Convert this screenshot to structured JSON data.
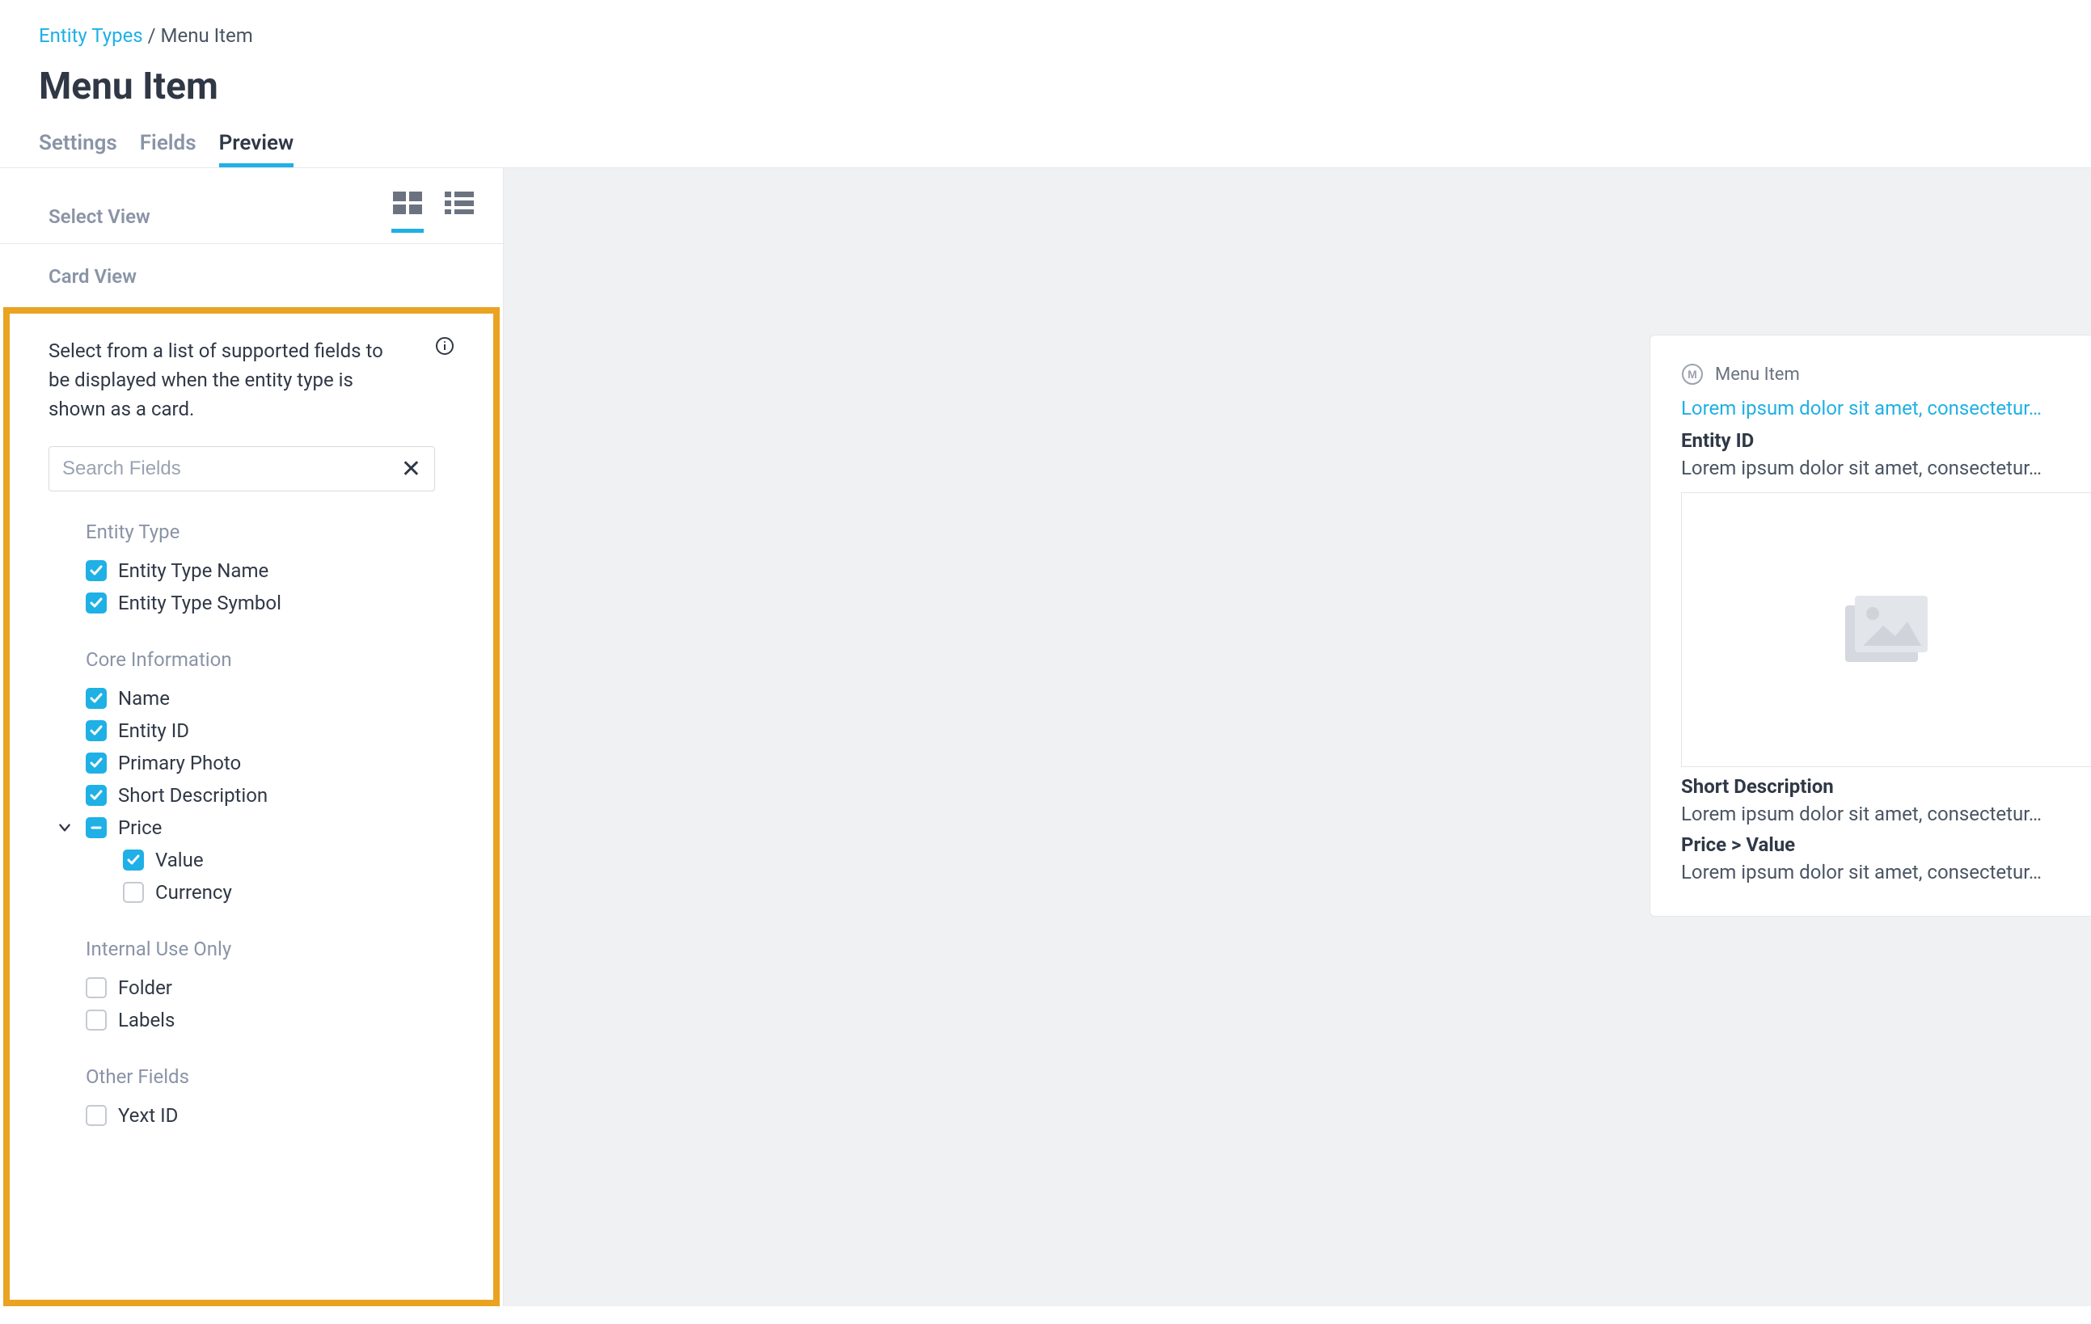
{
  "breadcrumb": {
    "root": "Entity Types",
    "separator": "/",
    "current": "Menu Item"
  },
  "page_title": "Menu Item",
  "tabs": {
    "settings": "Settings",
    "fields": "Fields",
    "preview": "Preview"
  },
  "left": {
    "select_view_label": "Select View",
    "card_view_heading": "Card View",
    "description": "Select from a list of supported fields to be displayed when the entity type is shown as a card.",
    "search_placeholder": "Search Fields",
    "groups": {
      "entity_type": {
        "label": "Entity Type",
        "items": {
          "name": "Entity Type Name",
          "symbol": "Entity Type Symbol"
        }
      },
      "core": {
        "label": "Core Information",
        "items": {
          "name": "Name",
          "entity_id": "Entity ID",
          "primary_photo": "Primary Photo",
          "short_description": "Short Description",
          "price": "Price",
          "value": "Value",
          "currency": "Currency"
        }
      },
      "internal": {
        "label": "Internal Use Only",
        "items": {
          "folder": "Folder",
          "labels": "Labels"
        }
      },
      "other": {
        "label": "Other Fields",
        "items": {
          "yext_id": "Yext ID"
        }
      }
    }
  },
  "preview": {
    "type_label": "Menu Item",
    "name_link": "Lorem ipsum dolor sit amet, consectetur…",
    "entity_id_label": "Entity ID",
    "entity_id_value": "Lorem ipsum dolor sit amet, consectetur…",
    "short_desc_label": "Short Description",
    "short_desc_value": "Lorem ipsum dolor sit amet, consectetur…",
    "price_label": "Price > Value",
    "price_value": "Lorem ipsum dolor sit amet, consectetur…"
  }
}
